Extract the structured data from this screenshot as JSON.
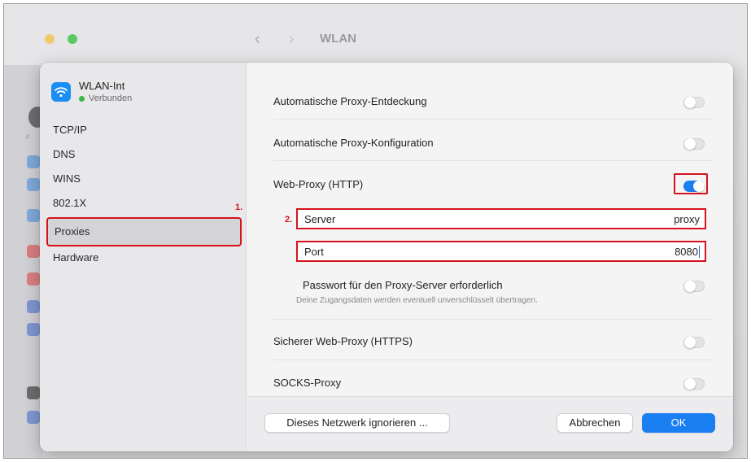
{
  "window": {
    "title": "WLAN"
  },
  "network": {
    "name": "WLAN-Int",
    "status": "Verbunden"
  },
  "sidebar": {
    "items": [
      {
        "label": "TCP/IP"
      },
      {
        "label": "DNS"
      },
      {
        "label": "WINS"
      },
      {
        "label": "802.1X"
      },
      {
        "label": "Proxies",
        "selected": true
      },
      {
        "label": "Hardware"
      }
    ]
  },
  "annotations": {
    "step1": "1.",
    "step2": "2."
  },
  "proxies": {
    "auto_discovery": {
      "label": "Automatische Proxy-Entdeckung",
      "enabled": false
    },
    "auto_config": {
      "label": "Automatische Proxy-Konfiguration",
      "enabled": false
    },
    "web_proxy": {
      "label": "Web-Proxy (HTTP)",
      "enabled": true
    },
    "server": {
      "label": "Server",
      "value": "proxy"
    },
    "port": {
      "label": "Port",
      "value": "8080"
    },
    "password": {
      "label": "Passwort für den Proxy-Server erforderlich",
      "hint": "Deine Zugangsdaten werden eventuell unverschlüsselt übertragen.",
      "enabled": false
    },
    "secure_web_proxy": {
      "label": "Sicherer Web-Proxy (HTTPS)",
      "enabled": false
    },
    "socks_proxy": {
      "label": "SOCKS-Proxy",
      "enabled": false
    }
  },
  "footer": {
    "ignore_label": "Dieses Netzwerk ignorieren ...",
    "cancel_label": "Abbrechen",
    "ok_label": "OK"
  },
  "colors": {
    "accent": "#1a7ff0",
    "annotation": "#d6121c",
    "connected": "#3cb846"
  }
}
